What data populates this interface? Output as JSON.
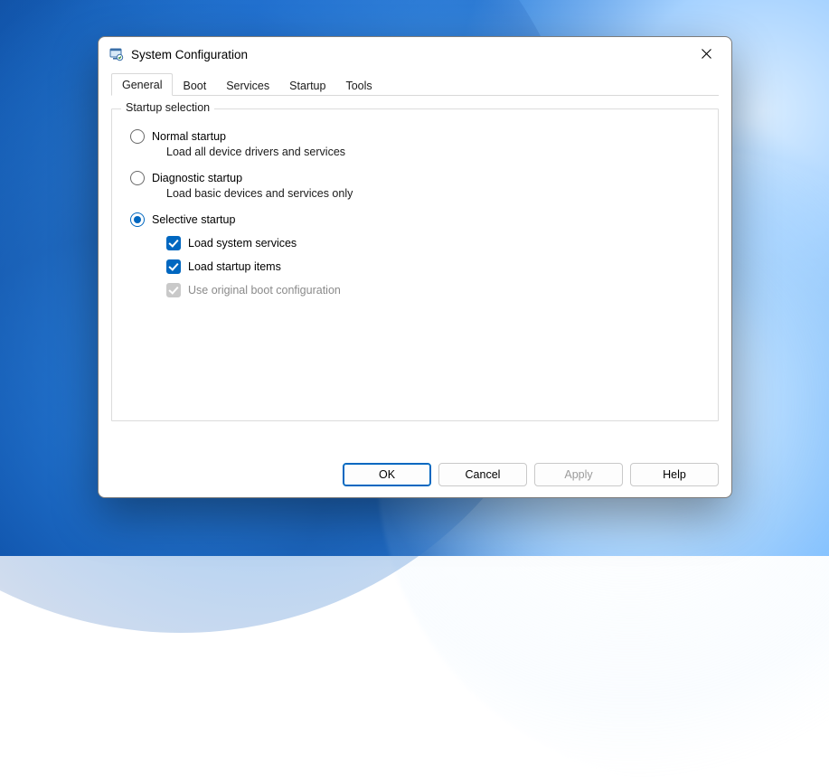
{
  "window": {
    "title": "System Configuration"
  },
  "tabs": {
    "general": "General",
    "boot": "Boot",
    "services": "Services",
    "startup": "Startup",
    "tools": "Tools"
  },
  "group": {
    "title": "Startup selection",
    "normal": {
      "label": "Normal startup",
      "desc": "Load all device drivers and services"
    },
    "diagnostic": {
      "label": "Diagnostic startup",
      "desc": "Load basic devices and services only"
    },
    "selective": {
      "label": "Selective startup",
      "check_services": "Load system services",
      "check_startup": "Load startup items",
      "check_original": "Use original boot configuration"
    }
  },
  "buttons": {
    "ok": "OK",
    "cancel": "Cancel",
    "apply": "Apply",
    "help": "Help"
  }
}
